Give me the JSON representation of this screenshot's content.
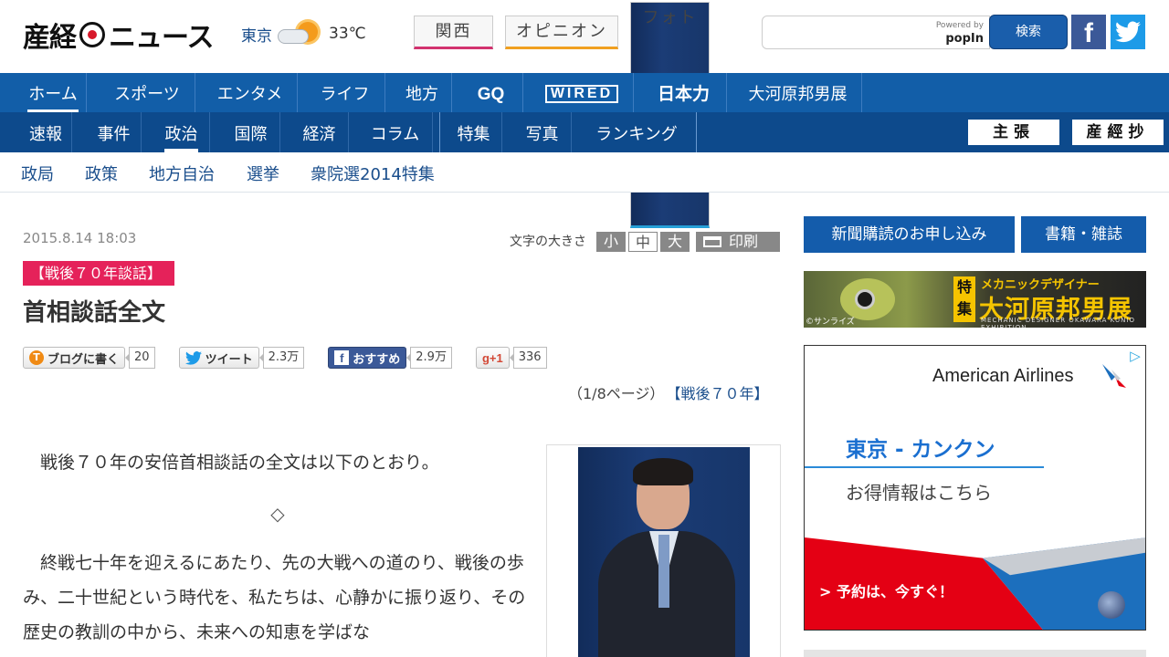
{
  "header": {
    "logo_left": "産経",
    "logo_right": "ニュース",
    "weather": {
      "city": "東京",
      "temp": "33℃"
    },
    "channel_tabs": [
      "関西",
      "オピニオン",
      "フォト"
    ],
    "search": {
      "placeholder": "",
      "powered_by": "Powered by",
      "provider": "popIn",
      "button": "検索"
    }
  },
  "nav_primary": {
    "items": [
      "ホーム",
      "スポーツ",
      "エンタメ",
      "ライフ",
      "地方"
    ],
    "brand_links": [
      "GQ",
      "WIRED",
      "日本力",
      "大河原邦男展"
    ]
  },
  "nav_secondary": {
    "items": [
      "速報",
      "事件",
      "政治",
      "国際",
      "経済",
      "コラム",
      "特集",
      "写真",
      "ランキング"
    ],
    "right_links": [
      "主張",
      "産經抄"
    ]
  },
  "nav_sub": {
    "items": [
      "政局",
      "政策",
      "地方自治",
      "選挙",
      "衆院選2014特集"
    ]
  },
  "article": {
    "datetime": "2015.8.14 18:03",
    "font_size_label": "文字の大きさ",
    "font_sizes": [
      "小",
      "中",
      "大"
    ],
    "print": "印刷",
    "tag": "【戦後７０年談話】",
    "title": "首相談話全文",
    "social": {
      "blog": {
        "label": "ブログに書く",
        "count": "20"
      },
      "tweet": {
        "label": "ツイート",
        "count": "2.3万"
      },
      "facebook": {
        "label": "おすすめ",
        "count": "2.9万"
      },
      "gplus": {
        "label": "g+1",
        "count": "336"
      }
    },
    "page_info": "（1/8ページ）",
    "series_link": "【戦後７０年】",
    "para1": "戦後７０年の安倍首相談話の全文は以下のとおり。",
    "divider": "◇",
    "para2": "終戦七十年を迎えるにあたり、先の大戦への道のり、戦後の歩み、二十世紀という時代を、私たちは、心静かに振り返り、その歴史の教訓の中から、未来への知恵を学ばな"
  },
  "sidebar": {
    "buttons": [
      "新聞購読のお申し込み",
      "書籍・雑誌"
    ],
    "banner": {
      "feature": "特集",
      "sub": "メカニックデザイナー",
      "main": "大河原邦男展",
      "eng": "MECHANIC DESIGNER OKAWARA KUNIO EXHIBITION",
      "copyright": "©サンライズ"
    },
    "ad": {
      "brand": "American Airlines",
      "route": "東京 - カンクン",
      "deal": "お得情報はこちら",
      "cta": "> 予約は、今すぐ！"
    }
  }
}
